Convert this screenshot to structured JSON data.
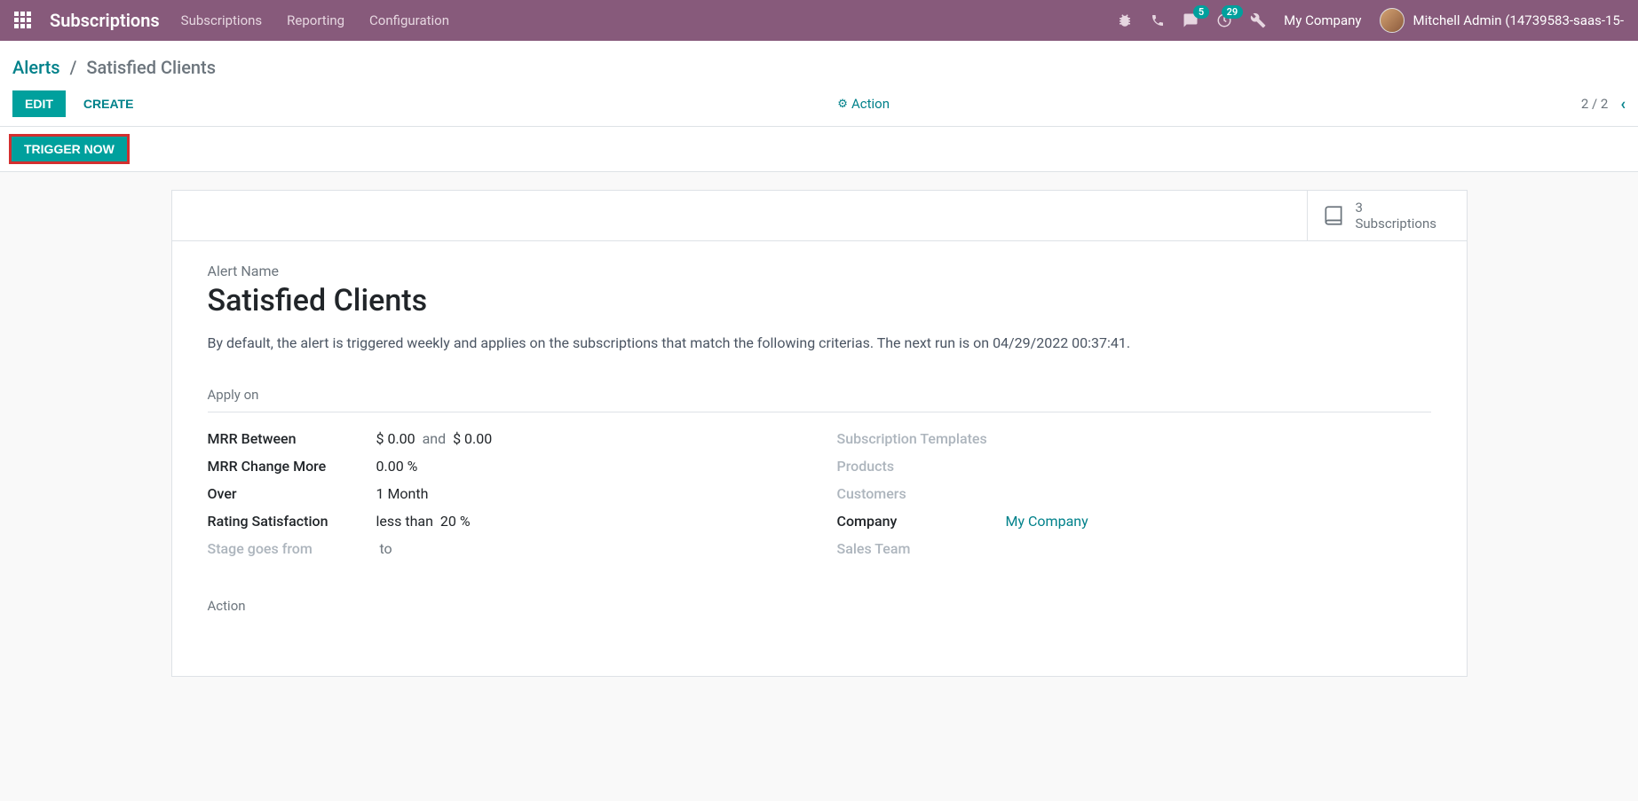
{
  "topbar": {
    "brand": "Subscriptions",
    "menu": [
      "Subscriptions",
      "Reporting",
      "Configuration"
    ],
    "badges": {
      "chat": "5",
      "clock": "29"
    },
    "company": "My Company",
    "user": "Mitchell Admin (14739583-saas-15-"
  },
  "breadcrumb": {
    "parent": "Alerts",
    "sep": "/",
    "current": "Satisfied Clients"
  },
  "controls": {
    "edit": "EDIT",
    "create": "CREATE",
    "action": "Action",
    "pager": "2 / 2"
  },
  "statusbar": {
    "trigger": "TRIGGER NOW"
  },
  "stat": {
    "count": "3",
    "label": "Subscriptions"
  },
  "form": {
    "nameLabel": "Alert Name",
    "title": "Satisfied Clients",
    "description": "By default, the alert is triggered weekly and applies on the subscriptions that match the following criterias. The next run is on 04/29/2022 00:37:41.",
    "applyOn": "Apply on",
    "actionSection": "Action",
    "left": {
      "mrrBetweenLabel": "MRR Between",
      "mrrBetween": {
        "from": "$ 0.00",
        "and": "and",
        "to": "$ 0.00"
      },
      "mrrChangeLabel": "MRR Change More",
      "mrrChange": "0.00  %",
      "overLabel": "Over",
      "over": "1 Month",
      "ratingLabel": "Rating Satisfaction",
      "rating": {
        "op": "less than",
        "val": "20 %"
      },
      "stageLabel": "Stage goes from",
      "stageTo": "to"
    },
    "right": {
      "templatesLabel": "Subscription Templates",
      "productsLabel": "Products",
      "customersLabel": "Customers",
      "companyLabel": "Company",
      "companyValue": "My Company",
      "salesTeamLabel": "Sales Team"
    }
  }
}
